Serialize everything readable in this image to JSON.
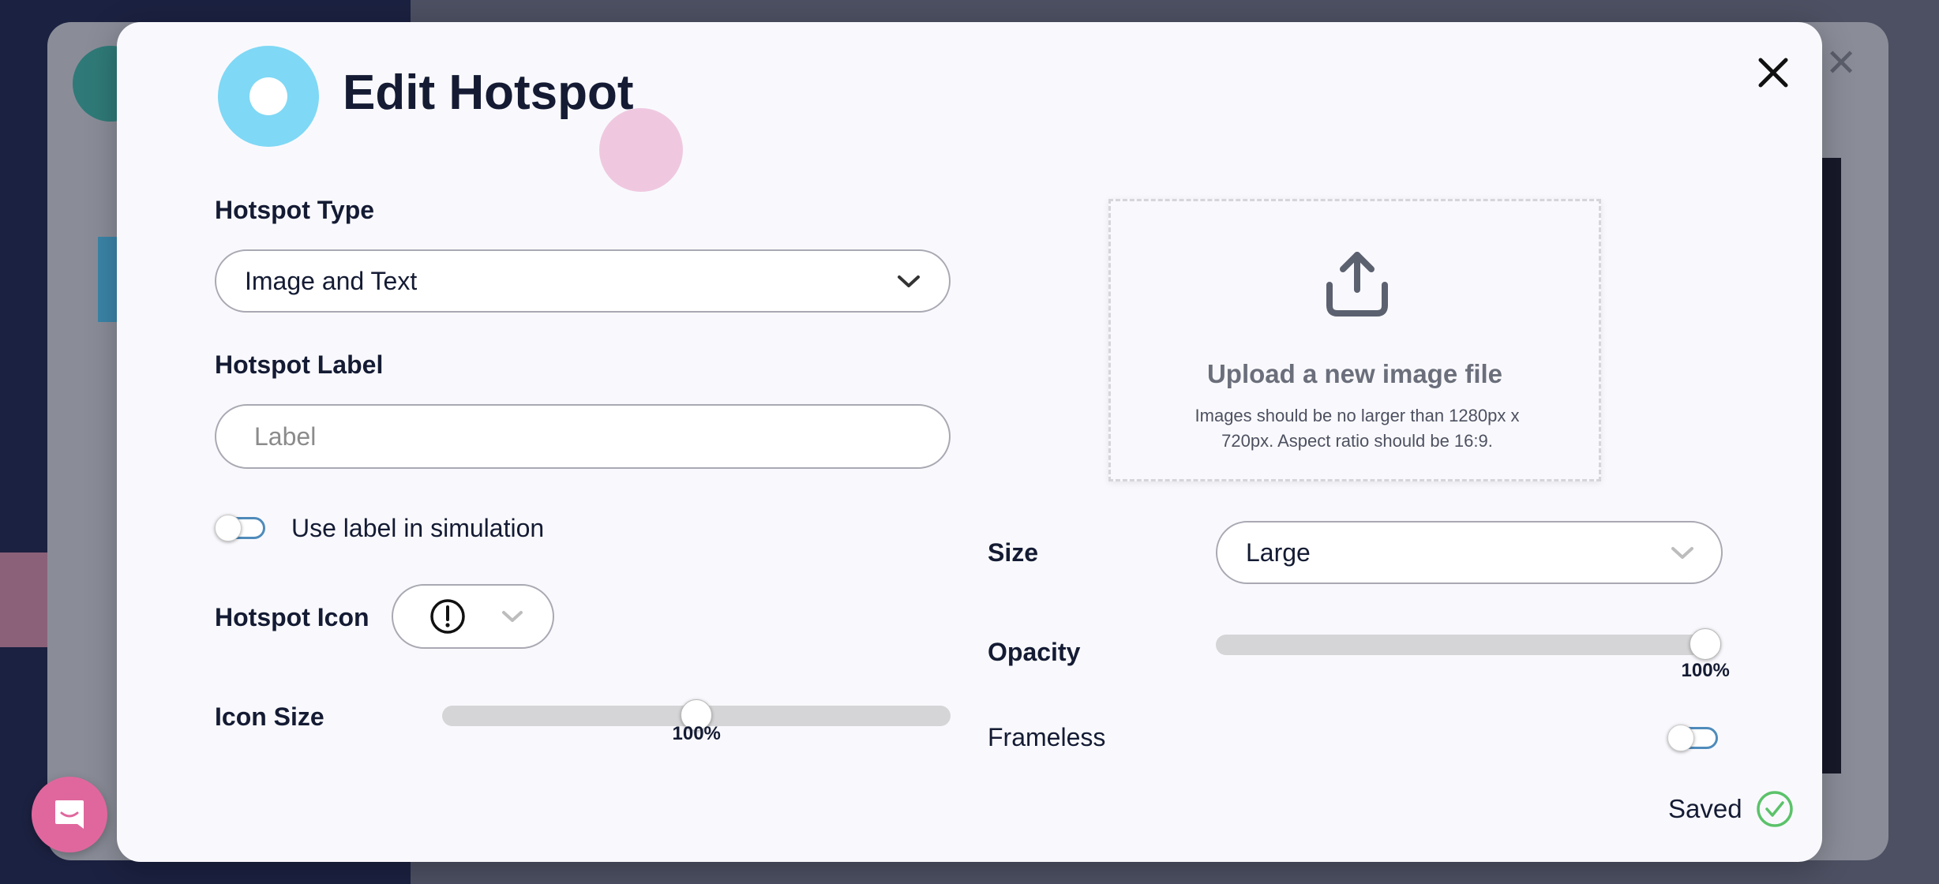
{
  "modal": {
    "title": "Edit Hotspot"
  },
  "left": {
    "hotspot_type_label": "Hotspot Type",
    "hotspot_type_value": "Image and Text",
    "hotspot_label_label": "Hotspot Label",
    "hotspot_label_placeholder": "Label",
    "hotspot_label_value": "",
    "use_label_text": "Use label in simulation",
    "use_label_enabled": false,
    "hotspot_icon_label": "Hotspot Icon",
    "hotspot_icon_value": "exclamation-circle-icon",
    "icon_size_label": "Icon Size",
    "icon_size_value": "100%",
    "icon_size_fraction": 0.5
  },
  "right": {
    "upload_title": "Upload a new image file",
    "upload_note": "Images should be no larger than 1280px x 720px. Aspect ratio should be 16:9.",
    "size_label": "Size",
    "size_value": "Large",
    "opacity_label": "Opacity",
    "opacity_value": "100%",
    "opacity_fraction": 1.0,
    "frameless_label": "Frameless",
    "frameless_enabled": false
  },
  "status": {
    "saved_text": "Saved"
  },
  "colors": {
    "logo": "#7fd8f5",
    "toggle_border": "#4f8bbb",
    "saved_check": "#5bc26a",
    "chat_button": "#e0679d",
    "title": "#141b33"
  }
}
